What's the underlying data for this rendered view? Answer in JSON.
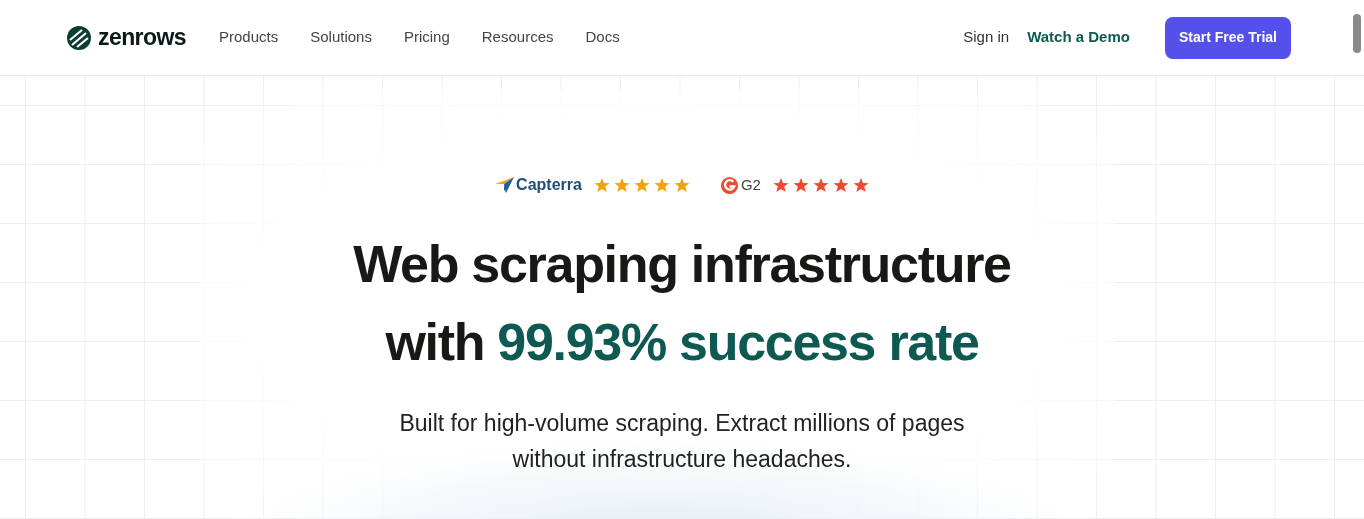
{
  "nav": {
    "logo": "zenrows",
    "links": [
      "Products",
      "Solutions",
      "Pricing",
      "Resources",
      "Docs"
    ],
    "sign_in": "Sign in",
    "demo": "Watch a Demo",
    "cta": "Start Free Trial"
  },
  "ratings": [
    {
      "kind": "capterra",
      "name": "Capterra",
      "stars": 5,
      "color": "#f5a10a"
    },
    {
      "kind": "g2",
      "name": "G2",
      "stars": 5,
      "color": "#ef4a2f"
    }
  ],
  "headline": [
    [
      {
        "text": "Web scraping infrastructure",
        "highlight": false
      }
    ],
    [
      {
        "text": "with ",
        "highlight": false
      },
      {
        "text": "99.93% success rate",
        "highlight": true
      }
    ]
  ],
  "subtitle": [
    "Built for high-volume scraping. Extract millions of pages",
    "without infrastructure headaches."
  ]
}
